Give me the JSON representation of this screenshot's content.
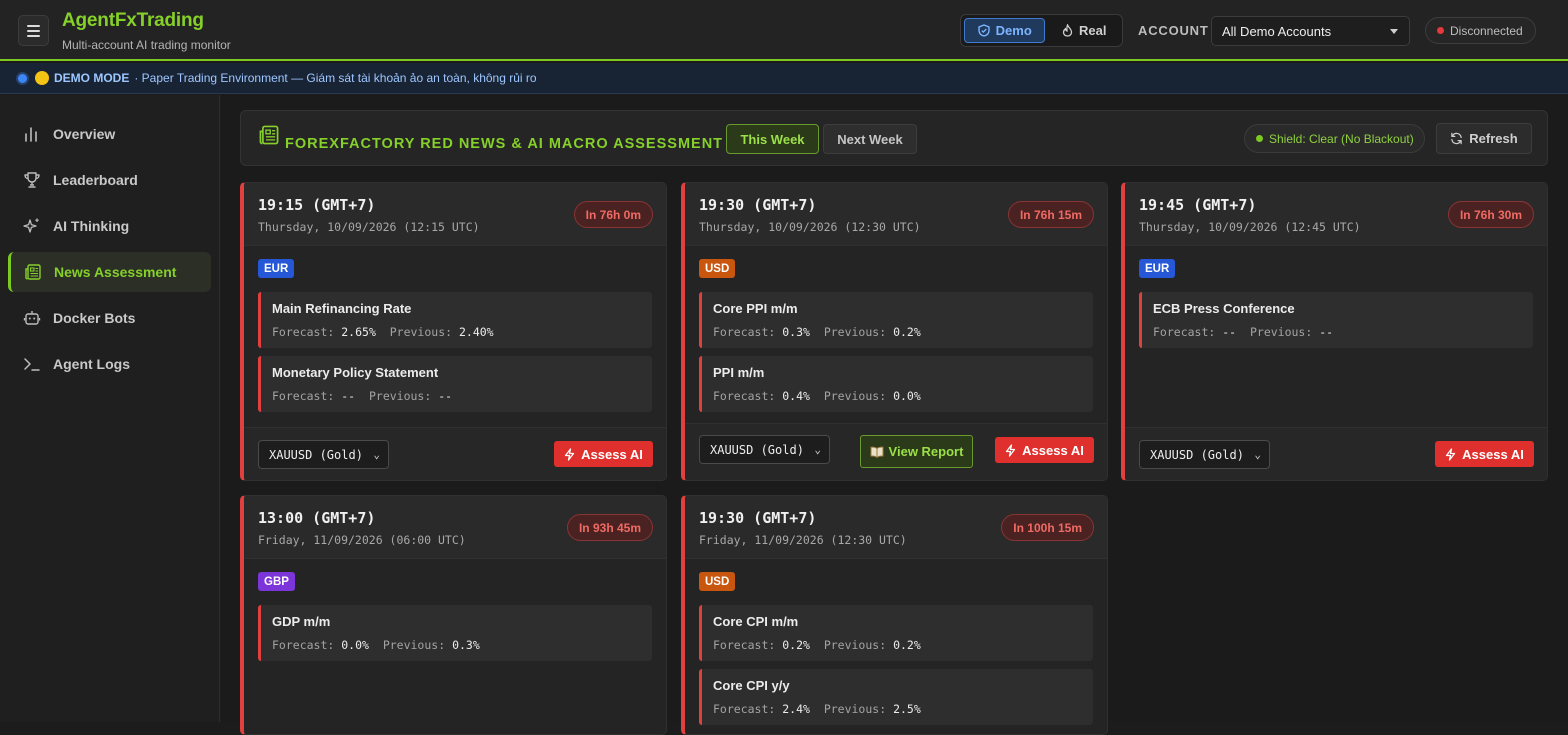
{
  "header": {
    "brand_title": "AgentFxTrading",
    "brand_subtitle": "Multi-account AI trading monitor",
    "mode_demo": "Demo",
    "mode_real": "Real",
    "account_label": "ACCOUNT",
    "account_value": "All Demo Accounts",
    "connection_status": "Disconnected"
  },
  "banner": {
    "mode": "DEMO MODE",
    "text": "· Paper Trading Environment — Giám sát tài khoản ảo an toàn, không rủi ro"
  },
  "sidebar": {
    "items": [
      {
        "label": "Overview",
        "icon": "bar-chart-icon"
      },
      {
        "label": "Leaderboard",
        "icon": "trophy-icon"
      },
      {
        "label": "AI Thinking",
        "icon": "sparkles-icon"
      },
      {
        "label": "News Assessment",
        "icon": "newspaper-icon",
        "active": true
      },
      {
        "label": "Docker Bots",
        "icon": "bot-icon"
      },
      {
        "label": "Agent Logs",
        "icon": "terminal-icon"
      }
    ]
  },
  "panel": {
    "title": "FOREXFACTORY RED NEWS & AI MACRO ASSESSMENT",
    "this_week": "This Week",
    "next_week": "Next Week",
    "shield": "Shield: Clear (No Blackout)",
    "refresh": "Refresh"
  },
  "labels": {
    "forecast": "Forecast:",
    "previous": "Previous:",
    "assess": "Assess AI",
    "view_report": "View Report"
  },
  "cards": [
    {
      "time": "19:15 (GMT+7)",
      "date": "Thursday, 10/09/2026 (12:15 UTC)",
      "eta": "In 76h 0m",
      "currency": "EUR",
      "pair": "XAUUSD (Gold)",
      "events": [
        {
          "name": "Main Refinancing Rate",
          "forecast": "2.65%",
          "previous": "2.40%"
        },
        {
          "name": "Monetary Policy Statement",
          "forecast": "--",
          "previous": "--"
        }
      ]
    },
    {
      "time": "19:30 (GMT+7)",
      "date": "Thursday, 10/09/2026 (12:30 UTC)",
      "eta": "In 76h 15m",
      "currency": "USD",
      "pair": "XAUUSD (Gold)",
      "events": [
        {
          "name": "Core PPI m/m",
          "forecast": "0.3%",
          "previous": "0.2%"
        },
        {
          "name": "PPI m/m",
          "forecast": "0.4%",
          "previous": "0.0%"
        }
      ]
    },
    {
      "time": "19:45 (GMT+7)",
      "date": "Thursday, 10/09/2026 (12:45 UTC)",
      "eta": "In 76h 30m",
      "currency": "EUR",
      "pair": "XAUUSD (Gold)",
      "events": [
        {
          "name": "ECB Press Conference",
          "forecast": "--",
          "previous": "--"
        }
      ]
    },
    {
      "time": "13:00 (GMT+7)",
      "date": "Friday, 11/09/2026 (06:00 UTC)",
      "eta": "In 93h 45m",
      "currency": "GBP",
      "events": [
        {
          "name": "GDP m/m",
          "forecast": "0.0%",
          "previous": "0.3%"
        }
      ]
    },
    {
      "time": "19:30 (GMT+7)",
      "date": "Friday, 11/09/2026 (12:30 UTC)",
      "eta": "In 100h 15m",
      "currency": "USD",
      "events": [
        {
          "name": "Core CPI m/m",
          "forecast": "0.2%",
          "previous": "0.2%"
        },
        {
          "name": "Core CPI y/y",
          "forecast": "2.4%",
          "previous": "2.5%"
        }
      ]
    }
  ],
  "colors": {
    "accent": "#86d02a",
    "danger": "#e0413e",
    "eur": "#2557d6",
    "usd": "#c8560f",
    "gbp": "#7b35d8"
  }
}
